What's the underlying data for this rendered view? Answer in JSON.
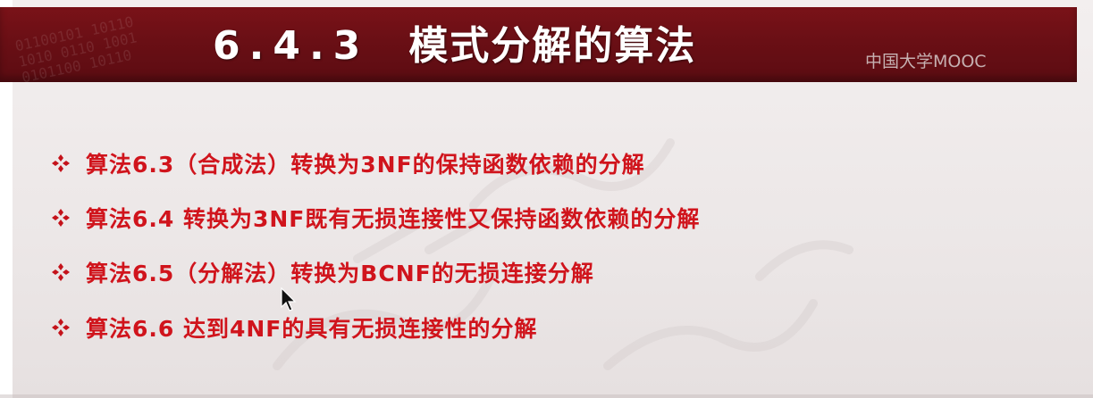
{
  "slide": {
    "title_number": "6.4.3",
    "title_text": "模式分解的算法",
    "logo_text": "中国大学MOOC",
    "watermark_icon": "faint-stamp-seal-watermark"
  },
  "bullets": [
    {
      "text": "算法6.3（合成法）转换为3NF的保持函数依赖的分解"
    },
    {
      "text": "算法6.4 转换为3NF既有无损连接性又保持函数依赖的分解"
    },
    {
      "text": "算法6.5（分解法）转换为BCNF的无损连接分解"
    },
    {
      "text": "算法6.6 达到4NF的具有无损连接性的分解"
    }
  ],
  "icons": {
    "bullet": "four-diamond-bullet-icon",
    "cursor": "mouse-cursor-icon"
  },
  "colors": {
    "title_bar": "#6a0f15",
    "title_text": "#ffffff",
    "bullet_text": "#d0141c",
    "bullet_icon": "#c4121a",
    "background": "#efeaea"
  }
}
